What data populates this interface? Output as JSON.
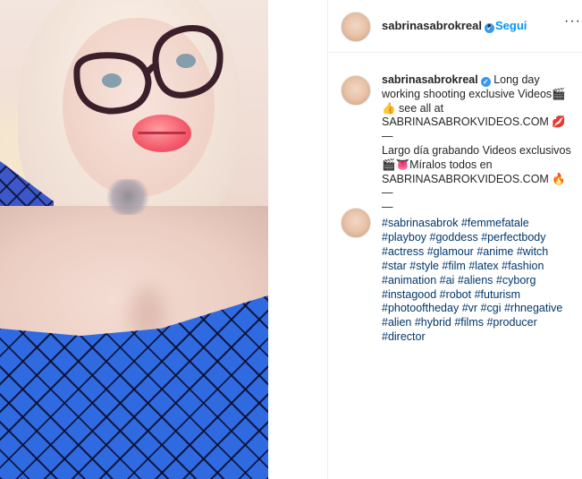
{
  "post": {
    "username": "sabrinasabrokreal",
    "follow_label": "Segui",
    "dot": "•",
    "more_label": "···"
  },
  "caption": {
    "lines": [
      "Long day working shooting exclusive Videos🎬",
      "👍 see all at",
      "SABRINASABROKVIDEOS.COM 💋",
      "—",
      "Largo día grabando Videos exclusivos",
      "🎬👅Míralos todos en",
      "SABRINASABROKVIDEOS.COM 🔥",
      "—",
      "—"
    ]
  },
  "hashtags": [
    "#sabrinasabrok",
    "#femmefatale",
    "#playboy",
    "#goddess",
    "#perfectbody",
    "#actress",
    "#glamour",
    "#anime",
    "#witch",
    "#star",
    "#style",
    "#film",
    "#latex",
    "#fashion",
    "#animation",
    "#ai",
    "#aliens",
    "#cyborg",
    "#instagood",
    "#robot",
    "#futurism",
    "#photooftheday",
    "#vr",
    "#cgi",
    "#rhnegative",
    "#alien",
    "#hybrid",
    "#films",
    "#producer",
    "#director"
  ],
  "colors": {
    "link": "#0095f6",
    "hashtag": "#00376b",
    "verified": "#3897f0",
    "netting": "#2f6ae0"
  },
  "icons": {
    "verified": "verified-badge-icon",
    "more": "more-options-icon"
  }
}
